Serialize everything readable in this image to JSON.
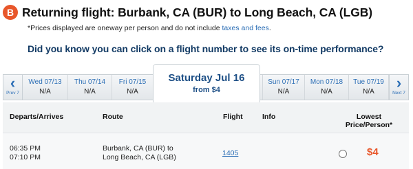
{
  "header": {
    "step": "B",
    "title": "Returning flight: Burbank, CA (BUR) to Long Beach, CA (LGB)"
  },
  "note": {
    "text": "*Prices displayed are oneway per person and do not include ",
    "link": "taxes and fees",
    "after": "."
  },
  "promo": "Did you know you can click on a flight number to see its on-time performance?",
  "date_strip": {
    "prev_label": "Prev 7",
    "next_label": "Next 7",
    "chevron_left": "‹",
    "chevron_right": "›",
    "days": [
      {
        "date": "Wed 07/13",
        "price": "N/A"
      },
      {
        "date": "Thu 07/14",
        "price": "N/A"
      },
      {
        "date": "Fri 07/15",
        "price": "N/A"
      },
      {
        "date": "Sun 07/17",
        "price": "N/A"
      },
      {
        "date": "Mon 07/18",
        "price": "N/A"
      },
      {
        "date": "Tue 07/19",
        "price": "N/A"
      }
    ],
    "selected": {
      "date": "Saturday Jul 16",
      "price": "from $4"
    }
  },
  "table": {
    "headers": {
      "departs_arrives": "Departs/Arrives",
      "route": "Route",
      "flight": "Flight",
      "info": "Info",
      "lowest_1": "Lowest",
      "lowest_2": "Price/Person*"
    },
    "rows": [
      {
        "depart": "06:35 PM",
        "arrive": "07:10 PM",
        "route_1": "Burbank, CA (BUR) to",
        "route_2": "Long Beach, CA (LGB)",
        "flight": "1405",
        "price": "$4"
      }
    ]
  },
  "colors": {
    "accent": "#e8562a",
    "link": "#2a6db5",
    "heading": "#123a64"
  }
}
